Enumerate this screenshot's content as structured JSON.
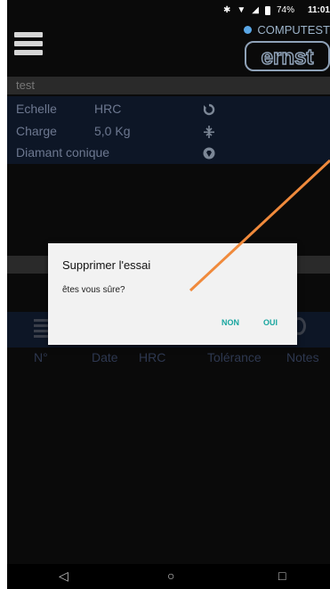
{
  "status": {
    "battery": "74%",
    "time": "11:01"
  },
  "brand": {
    "name": "COMPUTEST",
    "logo": "ernst"
  },
  "header": {
    "menu_icon": "hamburger-menu-icon"
  },
  "test": {
    "name": "test"
  },
  "info": [
    {
      "label": "Echelle",
      "value": "HRC",
      "icon": "refresh-icon"
    },
    {
      "label": "Charge",
      "value": "5,0 Kg",
      "icon": "compress-icon"
    },
    {
      "label": "Diamant conique",
      "value": "",
      "icon": "diamond-icon"
    }
  ],
  "columns": [
    "N°",
    "Date",
    "HRC",
    "Tolérance",
    "Notes"
  ],
  "dialog": {
    "title": "Supprimer l'essai",
    "message": "êtes vous sûre?",
    "no": "NON",
    "yes": "OUI"
  },
  "nav": {
    "back": "◁",
    "home": "○",
    "recents": "□"
  },
  "colors": {
    "accent": "#1aa6a0",
    "annotation": "#f08a3c"
  }
}
